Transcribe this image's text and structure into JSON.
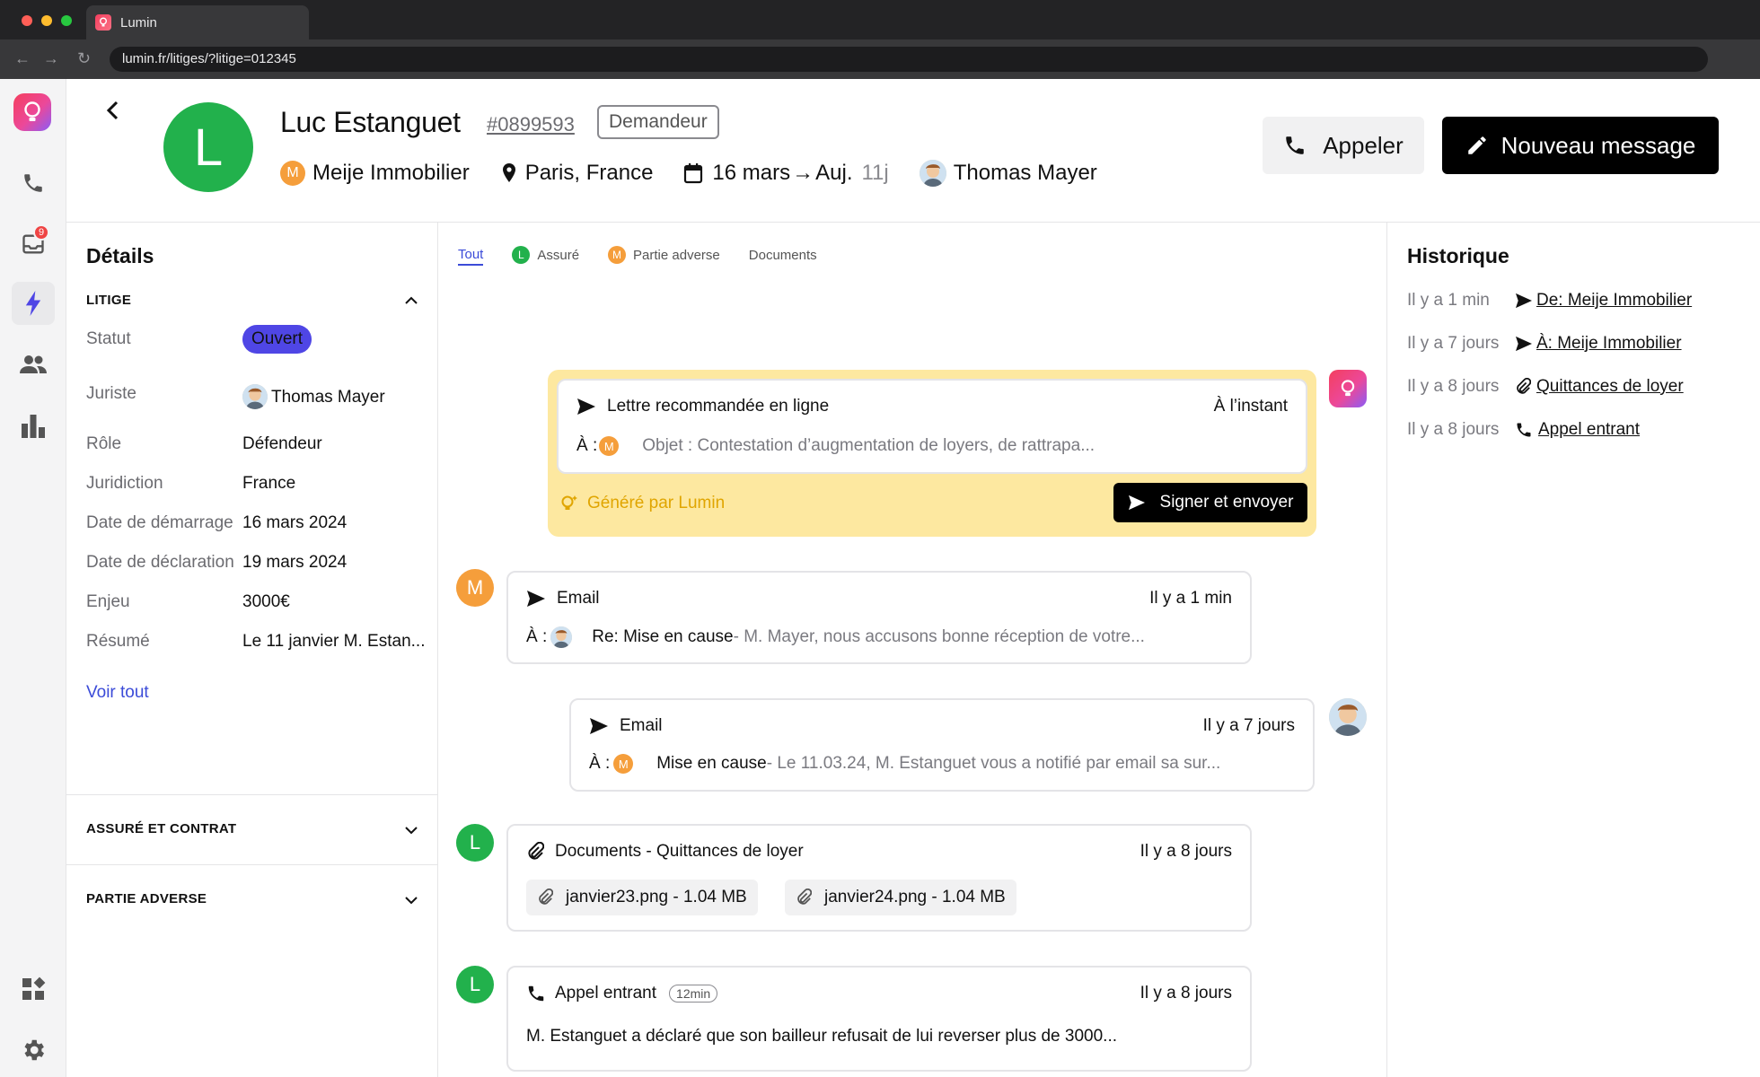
{
  "browser": {
    "tab_title": "Lumin",
    "url": "lumin.fr/litiges/?litige=012345"
  },
  "rail": {
    "inbox_badge": "9"
  },
  "header": {
    "avatar_letter": "L",
    "name": "Luc Estanguet",
    "reference": "#0899593",
    "role_badge": "Demandeur",
    "company_initial": "M",
    "company": "Meije Immobilier",
    "location": "Paris, France",
    "date_start": "16 mars",
    "arrow": "→",
    "date_end": "Auj.",
    "duration": "11j",
    "assignee": "Thomas Mayer",
    "call_label": "Appeler",
    "new_message_label": "Nouveau message"
  },
  "details": {
    "title": "Détails",
    "section_litige": "LITIGE",
    "rows": [
      {
        "label": "Statut",
        "value": "Ouvert"
      },
      {
        "label": "Juriste",
        "value": "Thomas Mayer"
      },
      {
        "label": "Rôle",
        "value": "Défendeur"
      },
      {
        "label": "Juridiction",
        "value": "France"
      },
      {
        "label": "Date de démarrage",
        "value": "16 mars 2024"
      },
      {
        "label": "Date de déclaration",
        "value": "19 mars 2024"
      },
      {
        "label": "Enjeu",
        "value": "3000€"
      },
      {
        "label": "Résumé",
        "value": "Le 11 janvier M. Estan..."
      }
    ],
    "see_all": "Voir tout",
    "section_assure": "ASSURÉ ET CONTRAT",
    "section_adverse": "PARTIE ADVERSE"
  },
  "feed_tabs": [
    {
      "label": "Tout",
      "initial": ""
    },
    {
      "label": "Assuré",
      "initial": "L"
    },
    {
      "label": "Partie adverse",
      "initial": "M"
    },
    {
      "label": "Documents",
      "initial": ""
    }
  ],
  "ai_card": {
    "title": "Lettre recommandée en ligne",
    "time": "À l’instant",
    "to_label": "À :",
    "to_initial": "M",
    "subject": "Objet : Contestation d’augmentation de loyers, de rattrapa...",
    "generated_by": "Généré par Lumin",
    "sign_label": "Signer et envoyer"
  },
  "feed": [
    {
      "avatar": "M",
      "type": "Email",
      "time": "Il y a 1 min",
      "to_label": "À :",
      "subject": "Re: Mise en cause",
      "preview": " - M. Mayer, nous accusons bonne réception de votre..."
    },
    {
      "avatar": "",
      "type": "Email",
      "time": "Il y a 7 jours",
      "to_label": "À :",
      "to_initial": "M",
      "subject": "Mise en cause",
      "preview": " - Le 11.03.24, M. Estanguet vous a notifié par email sa sur..."
    },
    {
      "avatar": "L",
      "type": "Documents - Quittances de loyer",
      "time": "Il y a 8 jours",
      "files": [
        "janvier23.png - 1.04 MB",
        "janvier24.png - 1.04 MB"
      ]
    },
    {
      "avatar": "L",
      "type": "Appel entrant",
      "duration": "12min",
      "time": "Il y a 8 jours",
      "text": "M. Estanguet a déclaré que son bailleur refusait de lui reverser plus de 3000..."
    }
  ],
  "history": {
    "title": "Historique",
    "items": [
      {
        "when": "Il y a 1 min",
        "icon": "send-icon",
        "label": "De: Meije Immobilier"
      },
      {
        "when": "Il y a 7 jours",
        "icon": "send-icon",
        "label": "À: Meije Immobilier"
      },
      {
        "when": "Il y a 8 jours",
        "icon": "paperclip-icon",
        "label": "Quittances de loyer"
      },
      {
        "when": "Il y a 8 jours",
        "icon": "phone-icon",
        "label": "Appel entrant"
      }
    ]
  },
  "colors": {
    "accent": "#4f46e5",
    "assure": "#22b14c",
    "adverse": "#f59e3b",
    "ai_bg": "#fde8a0"
  }
}
